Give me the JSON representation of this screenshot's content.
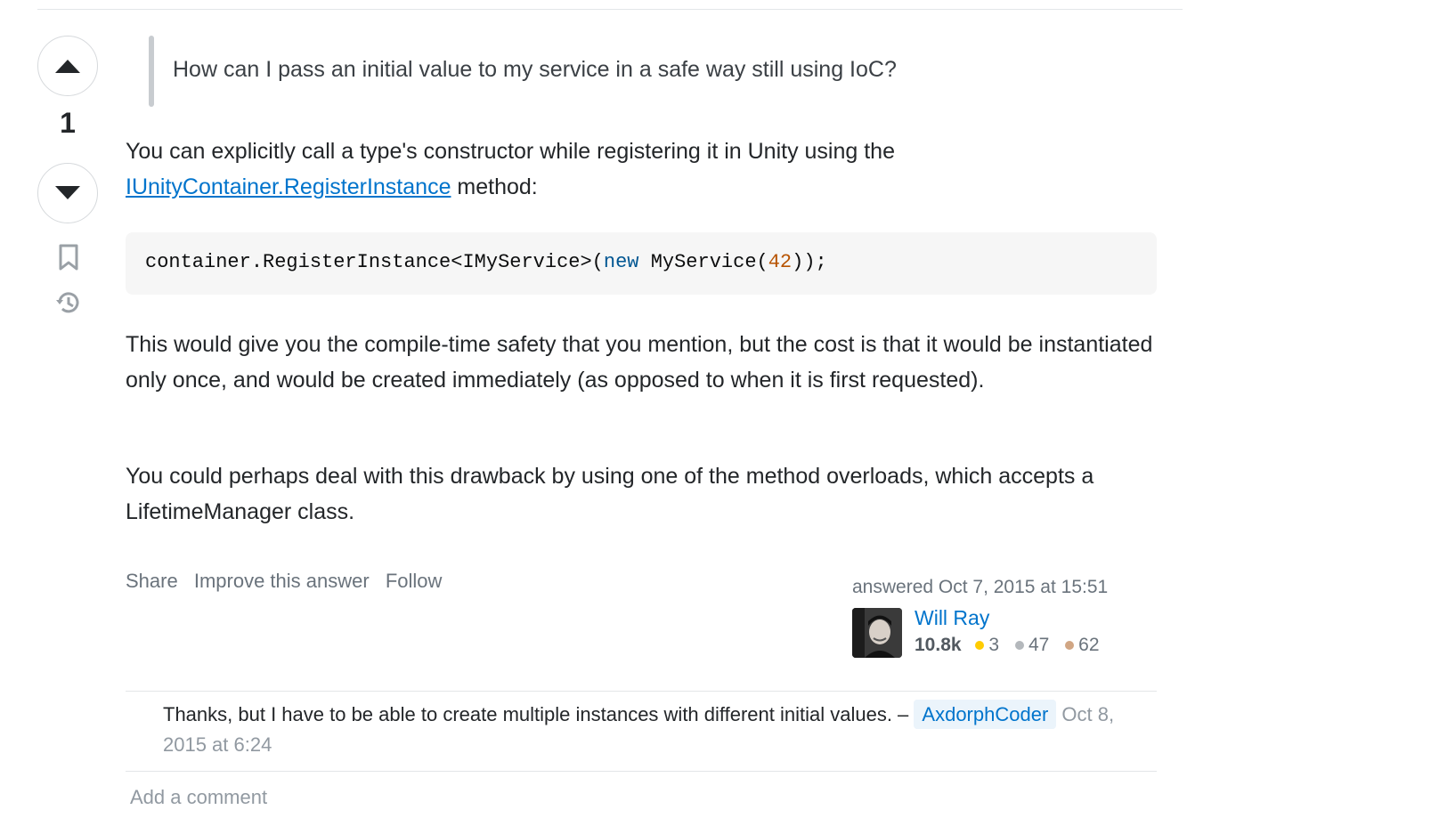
{
  "question_quote": "How can I pass an initial value to my service in a safe way still using IoC?",
  "vote": {
    "count": "1"
  },
  "answer": {
    "p1_text": "You can explicitly call a type's constructor while registering it in Unity using the",
    "p1_link": "IUnityContainer.RegisterInstance",
    "p1_after": " method:",
    "code": {
      "part1": "container.RegisterInstance<IMyService>(",
      "keyword": "new",
      "part2": " MyService(",
      "number": "42",
      "part3": "));"
    },
    "p2": "This would give you the compile-time safety that you mention, but the cost is that it would be instantiated only once, and would be created immediately (as opposed to when it is first requested).",
    "p3": "You could perhaps deal with this drawback by using one of the method overloads, which accepts a LifetimeManager class."
  },
  "post_menu": {
    "share": "Share",
    "improve": "Improve this answer",
    "follow": "Follow"
  },
  "user": {
    "answered": "answered Oct 7, 2015 at 15:51",
    "name": "Will Ray",
    "reputation": "10.8k",
    "gold": "3",
    "silver": "47",
    "bronze": "62"
  },
  "comment": {
    "text": "Thanks, but I have to be able to create multiple instances with different initial values. – ",
    "author": "AxdorphCoder",
    "date": "Oct 8, 2015 at 6:24"
  },
  "add_comment": "Add a comment",
  "icons": [
    "arrow-up-icon",
    "arrow-down-icon",
    "bookmark-icon",
    "history-icon"
  ],
  "colors": {
    "link": "#0074cc",
    "gold": "#ffcc01",
    "silver": "#b4b8bc",
    "bronze": "#d1a684"
  }
}
